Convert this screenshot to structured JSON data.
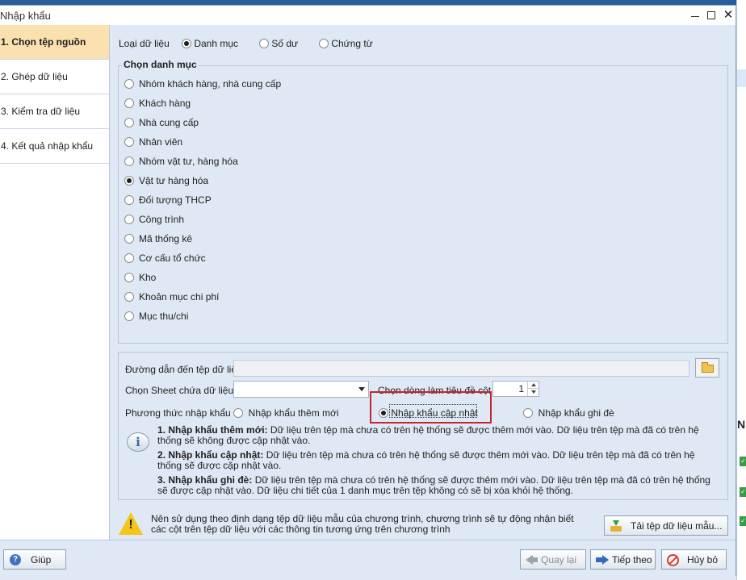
{
  "window": {
    "title": "Nhập khẩu"
  },
  "steps": [
    {
      "label": "1. Chọn tệp nguồn",
      "active": true
    },
    {
      "label": "2. Ghép dữ liệu",
      "active": false
    },
    {
      "label": "3. Kiểm tra dữ liệu",
      "active": false
    },
    {
      "label": "4. Kết quả nhập khẩu",
      "active": false
    }
  ],
  "data_type": {
    "label": "Loại dữ liệu",
    "options": [
      {
        "label": "Danh mục",
        "selected": true
      },
      {
        "label": "Số dư",
        "selected": false
      },
      {
        "label": "Chứng từ",
        "selected": false
      }
    ]
  },
  "category": {
    "legend": "Chọn danh mục",
    "items": [
      {
        "label": "Nhóm khách hàng, nhà cung cấp",
        "selected": false
      },
      {
        "label": "Khách hàng",
        "selected": false
      },
      {
        "label": "Nhà cung cấp",
        "selected": false
      },
      {
        "label": "Nhân viên",
        "selected": false
      },
      {
        "label": "Nhóm vật tư, hàng hóa",
        "selected": false
      },
      {
        "label": "Vật tư hàng hóa",
        "selected": true
      },
      {
        "label": "Đối tượng THCP",
        "selected": false
      },
      {
        "label": "Công trình",
        "selected": false
      },
      {
        "label": "Mã thống kê",
        "selected": false
      },
      {
        "label": "Cơ cấu tổ chức",
        "selected": false
      },
      {
        "label": "Kho",
        "selected": false
      },
      {
        "label": "Khoản mục chi phí",
        "selected": false
      },
      {
        "label": "Mục thu/chi",
        "selected": false
      }
    ]
  },
  "file": {
    "path_label": "Đường dẫn đến tệp dữ liệu",
    "path_value": "",
    "sheet_label": "Chọn Sheet chứa dữ liệu",
    "sheet_value": "",
    "header_row_label": "Chọn dòng làm tiêu đề cột",
    "header_row_value": "1"
  },
  "import_method": {
    "label": "Phương thức nhập khẩu",
    "options": [
      {
        "label": "Nhập khẩu thêm mới",
        "selected": false
      },
      {
        "label": "Nhập khẩu cập nhật",
        "selected": true
      },
      {
        "label": "Nhập khẩu ghi đè",
        "selected": false
      }
    ],
    "descriptions": [
      {
        "title": "1. Nhập khẩu thêm mới:",
        "text": " Dữ liệu trên tệp mà chưa có trên hệ thống sẽ được thêm mới vào. Dữ liệu trên tệp mà đã có trên hệ thống sẽ không được cập nhật vào."
      },
      {
        "title": "2. Nhập khẩu cập nhật:",
        "text": " Dữ liệu trên tệp mà chưa có trên hệ thống sẽ được thêm mới vào. Dữ liệu trên tệp mà đã có trên hệ thống sẽ được cập nhật vào."
      },
      {
        "title": "3. Nhập khẩu ghi đè:",
        "text": " Dữ liệu trên tệp mà chưa có trên hệ thống sẽ được thêm mới vào. Dữ liệu trên tệp mà đã có trên hệ thống sẽ được cập nhật vào. Dữ liệu chi tiết của 1 danh mục trên tệp không có sẽ bị xóa khỏi hệ thống."
      }
    ]
  },
  "notice": {
    "text": "Nên sử dụng theo định dạng tệp dữ liệu mẫu của chương trình, chương trình sẽ tự động nhận biết các cột trên tệp dữ liệu với các thông tin tương ứng trên chương trình",
    "download_label": "Tải tệp dữ liệu mẫu..."
  },
  "footer": {
    "help_label": "Giúp",
    "back_label": "Quay lại",
    "next_label": "Tiếp theo",
    "cancel_label": "Hủy bỏ"
  },
  "background": {
    "right_heading": "Nh",
    "tick_glyph": "✓"
  },
  "colors": {
    "active_step": "#fbe0b0",
    "highlight": "#c1272d",
    "panel": "#dfe9f5"
  }
}
